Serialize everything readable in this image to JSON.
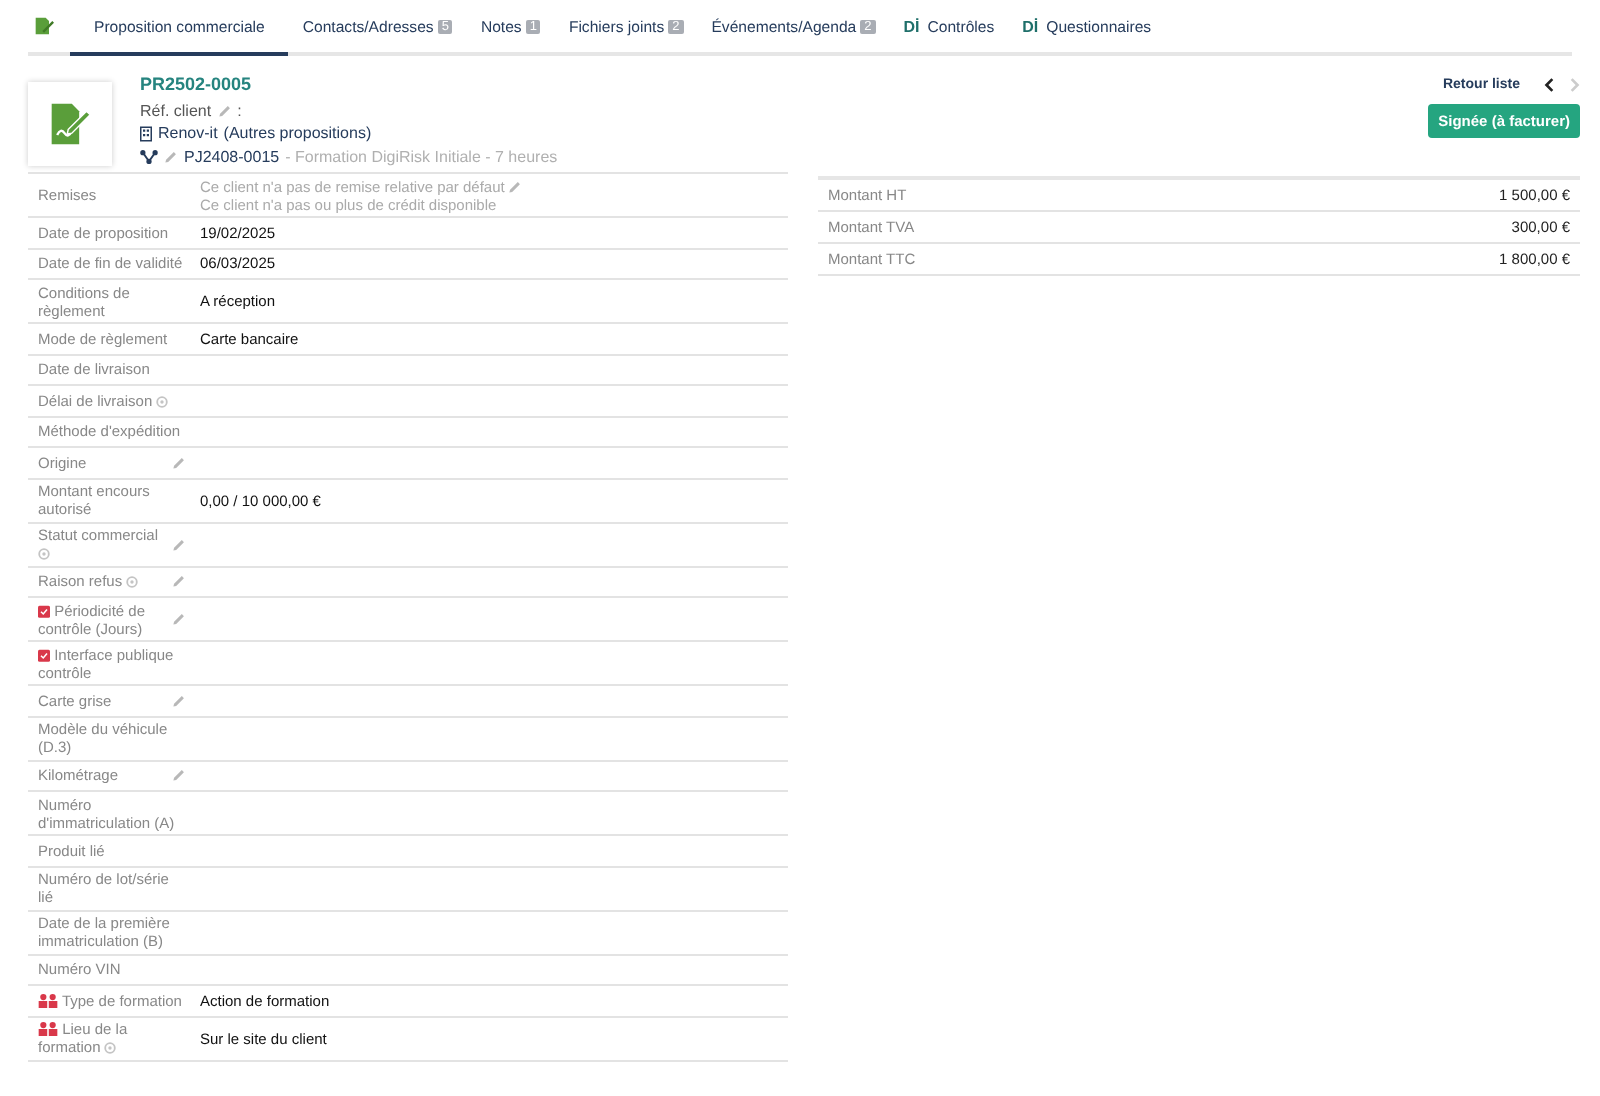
{
  "tabs": [
    {
      "kind": "icon",
      "selected": false
    },
    {
      "kind": "text",
      "label": "Proposition commerciale",
      "selected": true
    },
    {
      "kind": "text",
      "label": "Contacts/Adresses",
      "count": "5",
      "selected": false
    },
    {
      "kind": "text",
      "label": "Notes",
      "count": "1",
      "selected": false
    },
    {
      "kind": "text",
      "label": "Fichiers joints",
      "count": "2",
      "selected": false
    },
    {
      "kind": "text",
      "label": "Événements/Agenda",
      "count": "2",
      "selected": false
    },
    {
      "kind": "logo",
      "logo": "Dİ",
      "label": "Contrôles",
      "selected": false
    },
    {
      "kind": "logo",
      "logo": "Dİ",
      "label": "Questionnaires",
      "selected": false
    }
  ],
  "header": {
    "ref": "PR2502-0005",
    "ref_client_label": "Réf. client",
    "ref_client_sep": ":",
    "thirdparty": "Renov-it",
    "thirdparty_extra": "(Autres propositions)",
    "project": "PJ2408-0015",
    "project_title": "- Formation DigiRisk Initiale - 7 heures"
  },
  "nav": {
    "back_label": "Retour liste",
    "prev_disabled": false,
    "next_disabled": true
  },
  "status": "Signée (à facturer)",
  "fields": [
    {
      "kind": "plain",
      "label": "Remises",
      "notes": [
        "Ce client n'a pas de remise relative par défaut",
        "Ce client n'a pas ou plus de crédit disponible"
      ],
      "notes_editable": true
    },
    {
      "kind": "plain",
      "label": "Date de proposition",
      "value": "19/02/2025"
    },
    {
      "kind": "plain",
      "label": "Date de fin de validité",
      "value": "06/03/2025"
    },
    {
      "kind": "plain",
      "label": "Conditions de règlement",
      "value": "A réception"
    },
    {
      "kind": "plain",
      "label": "Mode de règlement",
      "value": "Carte bancaire"
    },
    {
      "kind": "plain",
      "label": "Date de livraison"
    },
    {
      "kind": "plain",
      "label": "Délai de livraison",
      "info": true
    },
    {
      "kind": "plain",
      "label": "Méthode d'expédition"
    },
    {
      "kind": "plain",
      "label": "Origine",
      "editable": true
    },
    {
      "kind": "plain",
      "label": "Montant encours autorisé",
      "value": "0,00 / 10 000,00 €"
    },
    {
      "kind": "plain",
      "label": "Statut commercial",
      "info": true,
      "editable": true
    },
    {
      "kind": "plain",
      "label": "Raison refus",
      "info": true,
      "editable": true
    },
    {
      "kind": "control",
      "label": "Périodicité de contrôle (Jours)",
      "editable": true
    },
    {
      "kind": "control",
      "label": "Interface publique contrôle"
    },
    {
      "kind": "plain",
      "label": "Carte grise",
      "editable": true
    },
    {
      "kind": "plain",
      "label": "Modèle du véhicule (D.3)"
    },
    {
      "kind": "plain",
      "label": "Kilométrage",
      "editable": true
    },
    {
      "kind": "plain",
      "label": "Numéro d'immatriculation (A)"
    },
    {
      "kind": "plain",
      "label": "Produit lié"
    },
    {
      "kind": "plain",
      "label": "Numéro de lot/série lié"
    },
    {
      "kind": "plain",
      "label": "Date de la première immatriculation (B)"
    },
    {
      "kind": "plain",
      "label": "Numéro VIN"
    },
    {
      "kind": "training",
      "label": "Type de formation",
      "value": "Action de formation"
    },
    {
      "kind": "training",
      "label": "Lieu de la formation",
      "info": true,
      "value": "Sur le site du client"
    }
  ],
  "totals": [
    {
      "label": "Montant HT",
      "value": "1 500,00 €"
    },
    {
      "label": "Montant TVA",
      "value": "300,00 €"
    },
    {
      "label": "Montant TTC",
      "value": "1 800,00 €"
    }
  ]
}
